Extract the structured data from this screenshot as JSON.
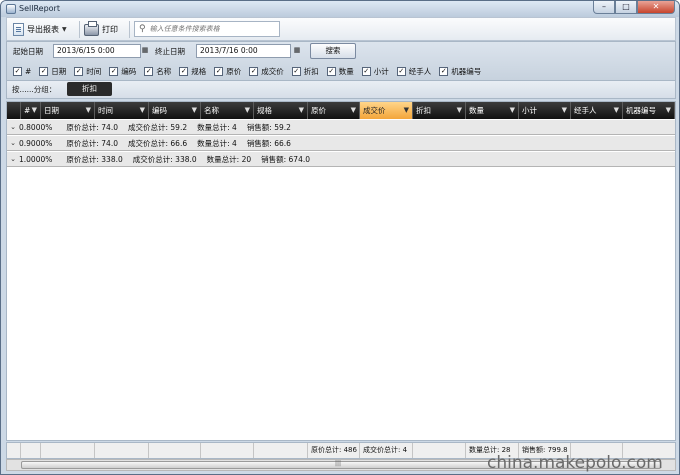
{
  "window": {
    "title": "SellReport",
    "min_glyph": "–",
    "max_glyph": "□",
    "close_glyph": "✕"
  },
  "toolbar": {
    "export_label": "导出报表",
    "print_label": "打印",
    "search_placeholder": "输入任意条件搜索表格"
  },
  "filters": {
    "start_label": "起始日期",
    "start_value": "2013/6/15 0:00",
    "end_label": "终止日期",
    "end_value": "2013/7/16 0:00",
    "search_button": "搜索",
    "columns": [
      {
        "label": "#",
        "checked": true
      },
      {
        "label": "日期",
        "checked": true
      },
      {
        "label": "时间",
        "checked": true
      },
      {
        "label": "编码",
        "checked": true
      },
      {
        "label": "名称",
        "checked": true
      },
      {
        "label": "规格",
        "checked": true
      },
      {
        "label": "原价",
        "checked": true
      },
      {
        "label": "成交价",
        "checked": true
      },
      {
        "label": "折扣",
        "checked": true
      },
      {
        "label": "数量",
        "checked": true
      },
      {
        "label": "小计",
        "checked": true
      },
      {
        "label": "经手人",
        "checked": true
      },
      {
        "label": "机器编号",
        "checked": true
      }
    ]
  },
  "grouping": {
    "label": "按......分组：",
    "chip": "折扣"
  },
  "grid": {
    "headers": [
      "#",
      "日期",
      "时间",
      "编码",
      "名称",
      "规格",
      "原价",
      "成交价",
      "折扣",
      "数量",
      "小计",
      "经手人",
      "机器编号"
    ],
    "active_header": "成交价",
    "groups": [
      {
        "title": "0.8000%",
        "orig": "原价总计: 74.0",
        "deal": "成交价总计: 59.2",
        "qty": "数量总计: 4",
        "sales": "销售额: 59.2"
      },
      {
        "title": "0.9000%",
        "orig": "原价总计: 74.0",
        "deal": "成交价总计: 66.6",
        "qty": "数量总计: 4",
        "sales": "销售额: 66.6"
      },
      {
        "title": "1.0000%",
        "orig": "原价总计: 338.0",
        "deal": "成交价总计: 338.0",
        "qty": "数量总计: 20",
        "sales": "销售额: 674.0"
      }
    ]
  },
  "footer": {
    "orig_total": "原价总计: 486",
    "deal_total": "成交价总计: 4",
    "qty_total": "数量总计: 28",
    "sales_total": "销售额: 799.8"
  },
  "watermark": "china.makepolo.com"
}
